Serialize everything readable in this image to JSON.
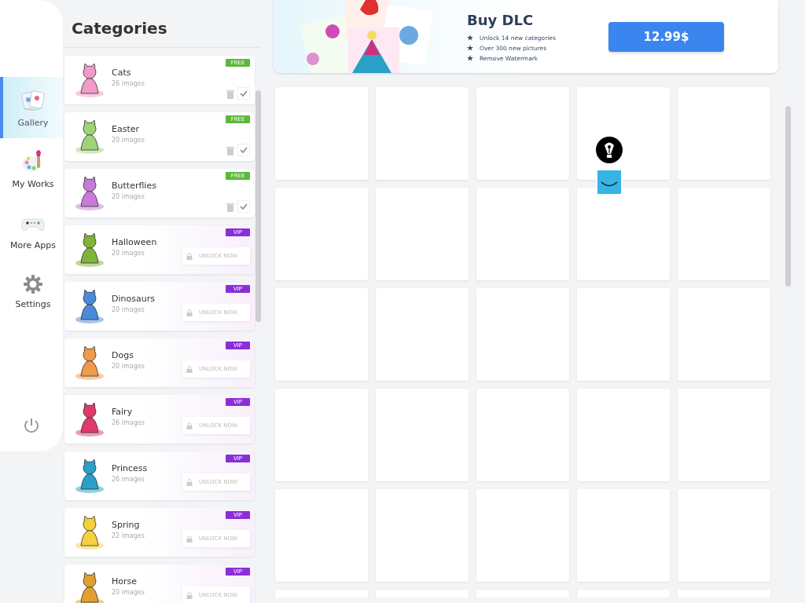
{
  "sidebar": {
    "items": [
      {
        "label": "Gallery",
        "kind": "gallery",
        "selected": true
      },
      {
        "label": "My Works",
        "kind": "works",
        "selected": false
      },
      {
        "label": "More Apps",
        "kind": "apps",
        "selected": false
      },
      {
        "label": "Settings",
        "kind": "settings",
        "selected": false
      }
    ]
  },
  "categories": {
    "title": "Categories",
    "items": [
      {
        "name": "Cats",
        "count": "26 images",
        "kind": "free",
        "badge": "FREE"
      },
      {
        "name": "Easter",
        "count": "20 images",
        "kind": "free",
        "badge": "FREE"
      },
      {
        "name": "Butterflies",
        "count": "20 images",
        "kind": "free",
        "badge": "FREE"
      },
      {
        "name": "Halloween",
        "count": "20 images",
        "kind": "vip",
        "badge": "VIP",
        "action": "UNLOCK NOW"
      },
      {
        "name": "Dinosaurs",
        "count": "20 images",
        "kind": "vip",
        "badge": "VIP",
        "action": "UNLOCK NOW"
      },
      {
        "name": "Dogs",
        "count": "20 images",
        "kind": "vip",
        "badge": "VIP",
        "action": "UNLOCK NOW"
      },
      {
        "name": "Fairy",
        "count": "26 images",
        "kind": "vip",
        "badge": "VIP",
        "action": "UNLOCK NOW"
      },
      {
        "name": "Princess",
        "count": "26 images",
        "kind": "vip",
        "badge": "VIP",
        "action": "UNLOCK NOW"
      },
      {
        "name": "Spring",
        "count": "22 images",
        "kind": "vip",
        "badge": "VIP",
        "action": "UNLOCK NOW"
      },
      {
        "name": "Horse",
        "count": "20 images",
        "kind": "vip",
        "badge": "VIP",
        "action": "UNLOCK NOW"
      }
    ]
  },
  "banner": {
    "title": "Buy DLC",
    "features": [
      "Unlock 14 new categories",
      "Over 300 new pictures",
      "Remove Watermark"
    ],
    "price": "12.99$"
  }
}
